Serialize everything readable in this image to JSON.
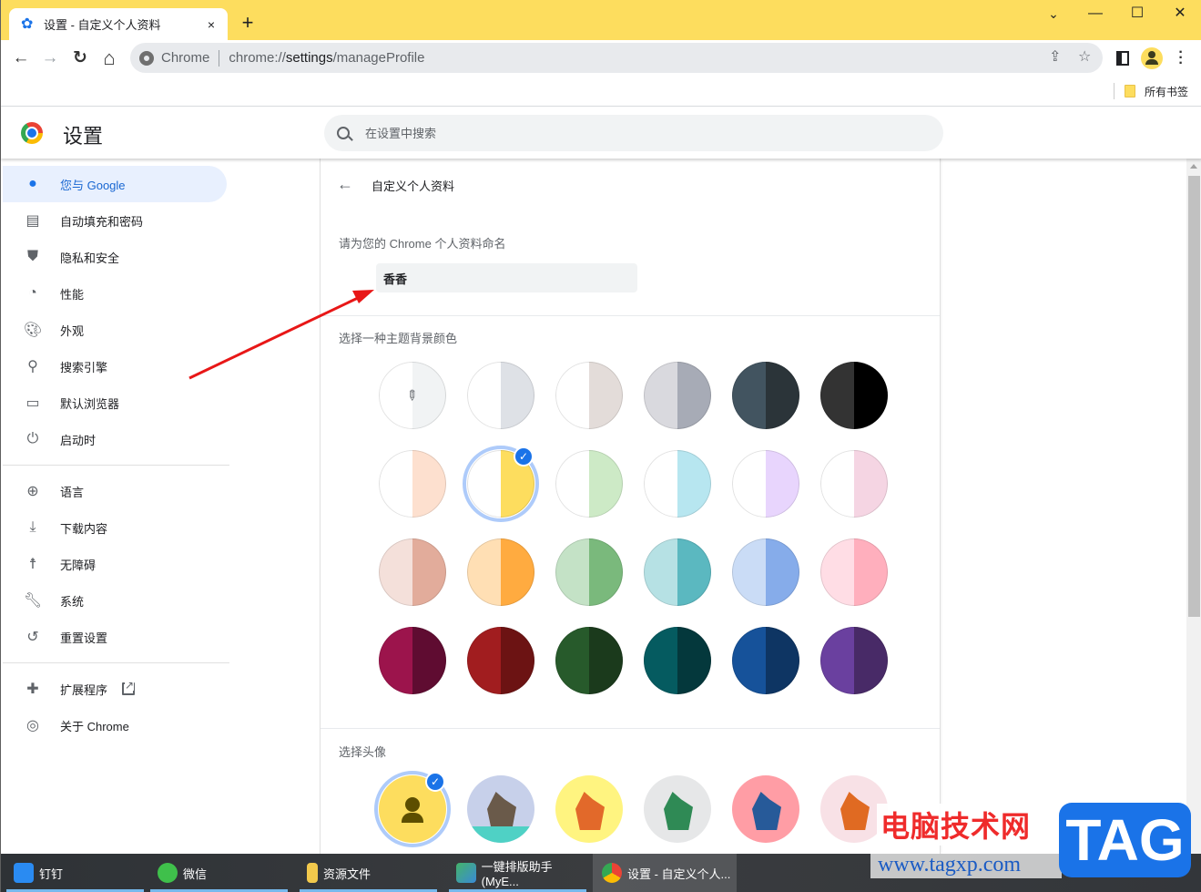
{
  "browser": {
    "tab_title": "设置 - 自定义个人资料",
    "tab_close": "×",
    "new_tab": "+",
    "window_controls": {
      "dropdown": "⌄",
      "minimize": "—",
      "maximize": "☐",
      "close": "✕"
    },
    "nav": {
      "back": "←",
      "forward": "→",
      "reload": "↻",
      "home": "⌂"
    },
    "omnibox": {
      "chip": "Chrome",
      "url_scheme": "chrome://",
      "url_host": "settings",
      "url_path": "/manageProfile"
    },
    "bookmarks": {
      "all_bookmarks": "所有书签"
    },
    "theme_color": "#fddd5e"
  },
  "settings": {
    "title": "设置",
    "search_placeholder": "在设置中搜索",
    "sidebar": [
      {
        "label": "您与 Google",
        "icon": "person-icon",
        "active": true
      },
      {
        "label": "自动填充和密码",
        "icon": "clipboard-icon"
      },
      {
        "label": "隐私和安全",
        "icon": "shield-icon"
      },
      {
        "label": "性能",
        "icon": "speedometer-icon"
      },
      {
        "label": "外观",
        "icon": "palette-icon"
      },
      {
        "label": "搜索引擎",
        "icon": "search-icon"
      },
      {
        "label": "默认浏览器",
        "icon": "browser-window-icon"
      },
      {
        "label": "启动时",
        "icon": "power-icon"
      },
      {
        "label": "语言",
        "icon": "globe-icon"
      },
      {
        "label": "下载内容",
        "icon": "download-icon"
      },
      {
        "label": "无障碍",
        "icon": "accessibility-icon"
      },
      {
        "label": "系统",
        "icon": "wrench-icon"
      },
      {
        "label": "重置设置",
        "icon": "history-reset-icon"
      },
      {
        "label": "扩展程序",
        "icon": "puzzle-icon",
        "external": true
      },
      {
        "label": "关于 Chrome",
        "icon": "chrome-icon"
      }
    ],
    "page": {
      "heading": "自定义个人资料",
      "name_label": "请为您的 Chrome 个人资料命名",
      "name_value": "香香",
      "theme_label": "选择一种主题背景颜色",
      "avatar_label": "选择头像",
      "theme_colors": [
        {
          "left": "#ffffff",
          "right": "#f1f3f4",
          "custom": true
        },
        {
          "left": "#ffffff",
          "right": "#dee1e6"
        },
        {
          "left": "#ffffff",
          "right": "#e3dcd9"
        },
        {
          "left": "#d9d9de",
          "right": "#a7abb6"
        },
        {
          "left": "#425460",
          "right": "#2b3439"
        },
        {
          "left": "#333333",
          "right": "#000000"
        },
        {
          "left": "#ffffff",
          "right": "#fde0cf"
        },
        {
          "left": "#ffffff",
          "right": "#fddd5e",
          "selected": true
        },
        {
          "left": "#ffffff",
          "right": "#cdeac6"
        },
        {
          "left": "#ffffff",
          "right": "#b7e6f0"
        },
        {
          "left": "#ffffff",
          "right": "#e8d5fd"
        },
        {
          "left": "#ffffff",
          "right": "#f5d5e3"
        },
        {
          "left": "#f4e0da",
          "right": "#e2ac9b"
        },
        {
          "left": "#ffdfb4",
          "right": "#ffab40"
        },
        {
          "left": "#c4e2c6",
          "right": "#7ab97c"
        },
        {
          "left": "#b6e1e4",
          "right": "#5bb8c0"
        },
        {
          "left": "#cadcf6",
          "right": "#86acea"
        },
        {
          "left": "#ffdde5",
          "right": "#ffafbd"
        },
        {
          "left": "#9c144c",
          "right": "#5f0c31"
        },
        {
          "left": "#a11d1f",
          "right": "#6c1313"
        },
        {
          "left": "#275a2b",
          "right": "#1b3a1c"
        },
        {
          "left": "#055b60",
          "right": "#04383c"
        },
        {
          "left": "#16529a",
          "right": "#0e3563"
        },
        {
          "left": "#6a409f",
          "right": "#482a67"
        }
      ],
      "avatars": [
        {
          "name": "default-person",
          "bg": "#fddd5e",
          "selected": true
        },
        {
          "name": "origami-cat",
          "bg": "#c7d0ea"
        },
        {
          "name": "origami-corgi",
          "bg": "#fff480"
        },
        {
          "name": "origami-dragon",
          "bg": "#e6e7e8"
        },
        {
          "name": "origami-elephant",
          "bg": "#ff9da5"
        },
        {
          "name": "origami-fox",
          "bg": "#f8e1e6"
        }
      ],
      "selected_check": "✓"
    }
  },
  "taskbar": [
    {
      "label": "钉钉",
      "icon": "dingtalk-icon"
    },
    {
      "label": "微信",
      "icon": "wechat-icon"
    },
    {
      "label": "资源文件",
      "icon": "folder-icon"
    },
    {
      "label": "一键排版助手(MyE...",
      "icon": "typeset-app-icon"
    },
    {
      "label": "设置 - 自定义个人...",
      "icon": "chrome-icon",
      "active": true
    }
  ],
  "watermark": {
    "cn": "电脑技术网",
    "url": "www.tagxp.com",
    "tag": "TAG"
  }
}
